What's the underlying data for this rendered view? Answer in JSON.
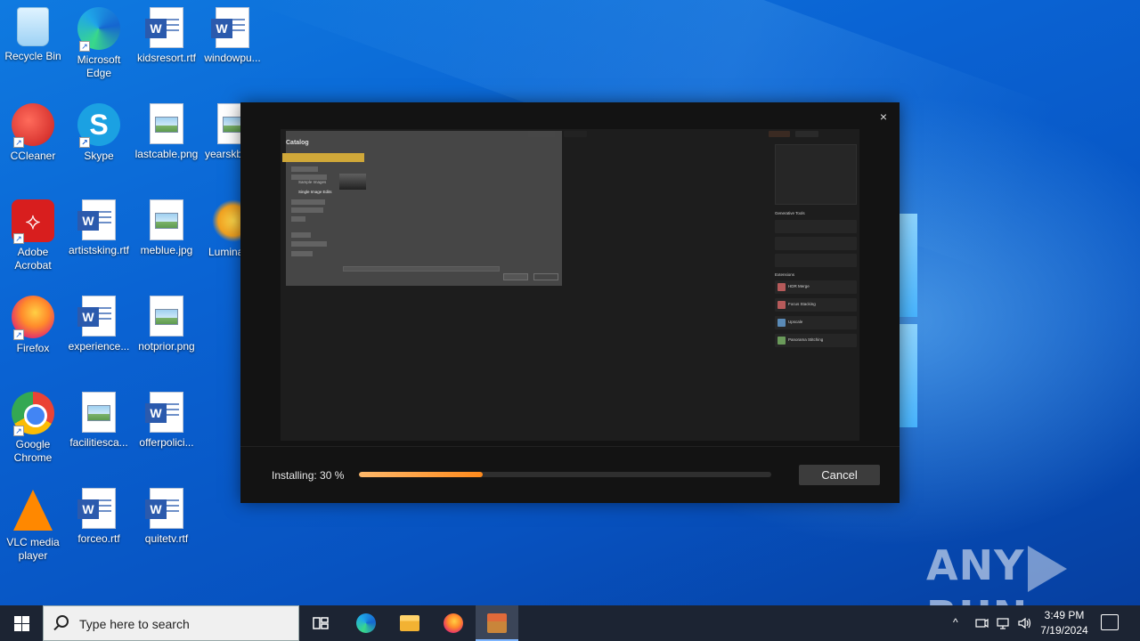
{
  "desktop": {
    "icons": [
      {
        "label": "Recycle Bin"
      },
      {
        "label": "Microsoft Edge"
      },
      {
        "label": "kidsresort.rtf"
      },
      {
        "label": "windowpu..."
      },
      {
        "label": "CCleaner"
      },
      {
        "label": "Skype"
      },
      {
        "label": "lastcable.png"
      },
      {
        "label": "yearskb..."
      },
      {
        "label": "Adobe Acrobat"
      },
      {
        "label": "artistsking.rtf"
      },
      {
        "label": "meblue.jpg"
      },
      {
        "label": "Lumina..."
      },
      {
        "label": "Firefox"
      },
      {
        "label": "experience..."
      },
      {
        "label": "notprior.png"
      },
      {
        "label": "Google Chrome"
      },
      {
        "label": "facilitiesca..."
      },
      {
        "label": "offerpolici..."
      },
      {
        "label": "VLC media player"
      },
      {
        "label": "forceo.rtf"
      },
      {
        "label": "quitetv.rtf"
      }
    ]
  },
  "installer": {
    "status_text": "Installing: 30 %",
    "progress_percent": 30,
    "cancel_label": "Cancel",
    "close_glyph": "×",
    "preview": {
      "catalog_title": "Catalog",
      "single_image_edits": "Single Image Edits",
      "sample_images": "Sample Images",
      "generative_tools": "Generative Tools",
      "extensions": "Extensions",
      "ext_items": [
        "HDR Merge",
        "Focus Stacking",
        "Upscale",
        "Panorama Stitching"
      ]
    }
  },
  "watermark": {
    "text_left": "ANY",
    "text_right": "RUN"
  },
  "taskbar": {
    "search_placeholder": "Type here to search",
    "time": "3:49 PM",
    "date": "7/19/2024"
  },
  "colors": {
    "accent_progress": "#ff8a1c",
    "taskbar_bg": "#1c2433",
    "desktop_bg": "#0a63d3"
  }
}
